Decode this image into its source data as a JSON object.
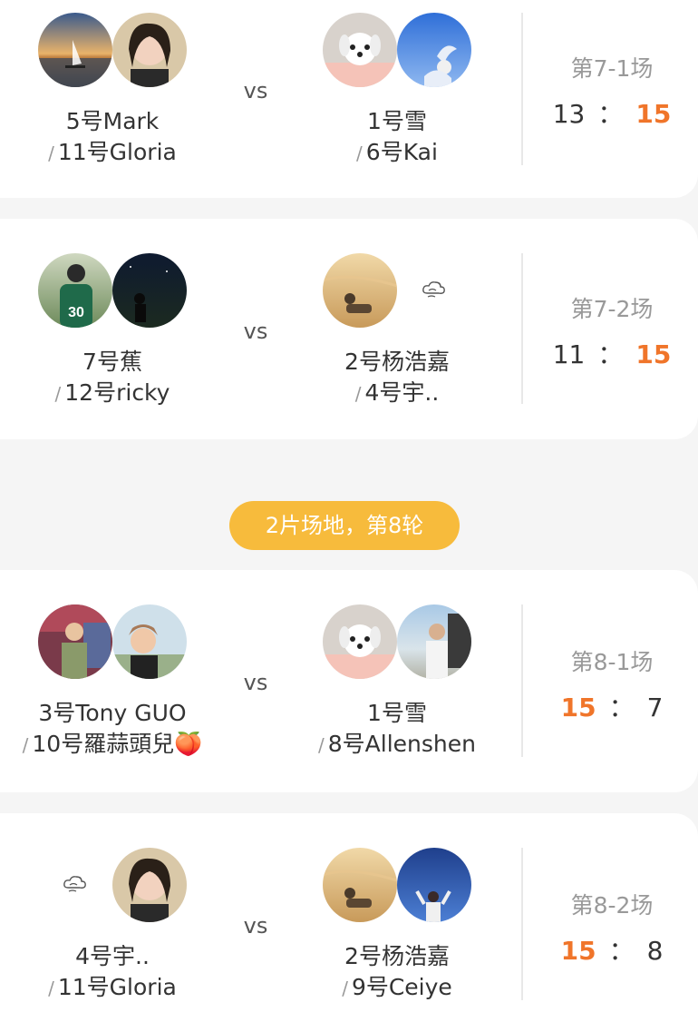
{
  "separator": {
    "label": "2片场地，第8轮"
  },
  "matches": [
    {
      "left": {
        "player1": "5号Mark",
        "player2": "11号Gloria"
      },
      "right": {
        "player1": "1号雪",
        "player2": "6号Kai"
      },
      "vs": "vs",
      "round": "第7-1场",
      "score_left": "13",
      "score_right": "15",
      "colon": "："
    },
    {
      "left": {
        "player1": "7号蕉",
        "player2": "12号ricky"
      },
      "right": {
        "player1": "2号杨浩嘉",
        "player2": "4号宇.."
      },
      "vs": "vs",
      "round": "第7-2场",
      "score_left": "11",
      "score_right": "15",
      "colon": "："
    },
    {
      "left": {
        "player1": "3号Tony GUO",
        "player2": "10号羅蒜頭兒🍑"
      },
      "right": {
        "player1": "1号雪",
        "player2": "8号Allenshen"
      },
      "vs": "vs",
      "round": "第8-1场",
      "score_left": "15",
      "score_right": "7",
      "colon": "："
    },
    {
      "left": {
        "player1": "4号宇..",
        "player2": "11号Gloria"
      },
      "right": {
        "player1": "2号杨浩嘉",
        "player2": "9号Ceiye"
      },
      "vs": "vs",
      "round": "第8-2场",
      "score_left": "15",
      "score_right": "8",
      "colon": "："
    }
  ],
  "slash": "/",
  "colors": {
    "accent": "#f0752a",
    "pill": "#f7bb3c"
  }
}
